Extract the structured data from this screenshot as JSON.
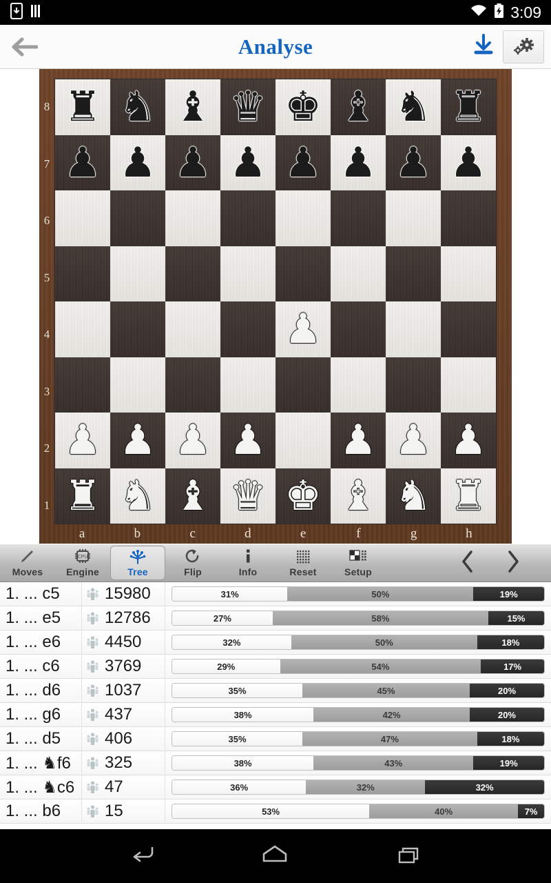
{
  "statusbar": {
    "time": "3:09",
    "icons": [
      "download-notification-icon",
      "signal-bars-icon",
      "wifi-icon",
      "battery-icon"
    ]
  },
  "header": {
    "title": "Analyse",
    "back_label": "Back",
    "download_label": "Download",
    "settings_label": "Settings",
    "accent_color": "#1565c0"
  },
  "board": {
    "files": [
      "a",
      "b",
      "c",
      "d",
      "e",
      "f",
      "g",
      "h"
    ],
    "ranks": [
      "8",
      "7",
      "6",
      "5",
      "4",
      "3",
      "2",
      "1"
    ],
    "position": [
      [
        "r",
        "n",
        "b",
        "q",
        "k",
        "b",
        "n",
        "r"
      ],
      [
        "p",
        "p",
        "p",
        "p",
        "p",
        "p",
        "p",
        "p"
      ],
      [
        "",
        "",
        "",
        "",
        "",
        "",
        "",
        ""
      ],
      [
        "",
        "",
        "",
        "",
        "",
        "",
        "",
        ""
      ],
      [
        "",
        "",
        "",
        "",
        "P",
        "",
        "",
        ""
      ],
      [
        "",
        "",
        "",
        "",
        "",
        "",
        "",
        ""
      ],
      [
        "P",
        "P",
        "P",
        "P",
        "",
        "P",
        "P",
        "P"
      ],
      [
        "R",
        "N",
        "B",
        "Q",
        "K",
        "B",
        "N",
        "R"
      ]
    ],
    "light_square_color": "#eceae6",
    "dark_square_color": "#3a312d",
    "frame_color": "#5d3820"
  },
  "toolbar": {
    "items": [
      {
        "label": "Moves",
        "icon": "pencil-icon",
        "active": false
      },
      {
        "label": "Engine",
        "icon": "cpu-icon",
        "active": false
      },
      {
        "label": "Tree",
        "icon": "tree-icon",
        "active": true
      },
      {
        "label": "Flip",
        "icon": "rotate-icon",
        "active": false
      },
      {
        "label": "Info",
        "icon": "info-icon",
        "active": false
      },
      {
        "label": "Reset",
        "icon": "dot-grid-icon",
        "active": false
      },
      {
        "label": "Setup",
        "icon": "chessboard-icon",
        "active": false
      }
    ],
    "prev_label": "Previous",
    "next_label": "Next"
  },
  "tree": {
    "rows": [
      {
        "move": "1. ... c5",
        "piece": "",
        "square": "c5",
        "games": "15980",
        "win": 31,
        "draw": 50,
        "loss": 19,
        "win_label": "31%",
        "draw_label": "50%",
        "loss_label": "19%"
      },
      {
        "move": "1. ... e5",
        "piece": "",
        "square": "e5",
        "games": "12786",
        "win": 27,
        "draw": 58,
        "loss": 15,
        "win_label": "27%",
        "draw_label": "58%",
        "loss_label": "15%"
      },
      {
        "move": "1. ... e6",
        "piece": "",
        "square": "e6",
        "games": "4450",
        "win": 32,
        "draw": 50,
        "loss": 18,
        "win_label": "32%",
        "draw_label": "50%",
        "loss_label": "18%"
      },
      {
        "move": "1. ... c6",
        "piece": "",
        "square": "c6",
        "games": "3769",
        "win": 29,
        "draw": 54,
        "loss": 17,
        "win_label": "29%",
        "draw_label": "54%",
        "loss_label": "17%"
      },
      {
        "move": "1. ... d6",
        "piece": "",
        "square": "d6",
        "games": "1037",
        "win": 35,
        "draw": 45,
        "loss": 20,
        "win_label": "35%",
        "draw_label": "45%",
        "loss_label": "20%"
      },
      {
        "move": "1. ... g6",
        "piece": "",
        "square": "g6",
        "games": "437",
        "win": 38,
        "draw": 42,
        "loss": 20,
        "win_label": "38%",
        "draw_label": "42%",
        "loss_label": "20%"
      },
      {
        "move": "1. ... d5",
        "piece": "",
        "square": "d5",
        "games": "406",
        "win": 35,
        "draw": 47,
        "loss": 18,
        "win_label": "35%",
        "draw_label": "47%",
        "loss_label": "18%"
      },
      {
        "move": "1. ... ♞f6",
        "piece": "♞",
        "square": "f6",
        "games": "325",
        "win": 38,
        "draw": 43,
        "loss": 19,
        "win_label": "38%",
        "draw_label": "43%",
        "loss_label": "19%"
      },
      {
        "move": "1. ... ♞c6",
        "piece": "♞",
        "square": "c6",
        "games": "47",
        "win": 36,
        "draw": 32,
        "loss": 32,
        "win_label": "36%",
        "draw_label": "32%",
        "loss_label": "32%"
      },
      {
        "move": "1. ... b6",
        "piece": "",
        "square": "b6",
        "games": "15",
        "win": 53,
        "draw": 40,
        "loss": 7,
        "win_label": "53%",
        "draw_label": "40%",
        "loss_label": "7%"
      }
    ],
    "games_icon": "people-icon"
  },
  "navbar": {
    "back_label": "Back",
    "home_label": "Home",
    "recents_label": "Recent apps"
  }
}
